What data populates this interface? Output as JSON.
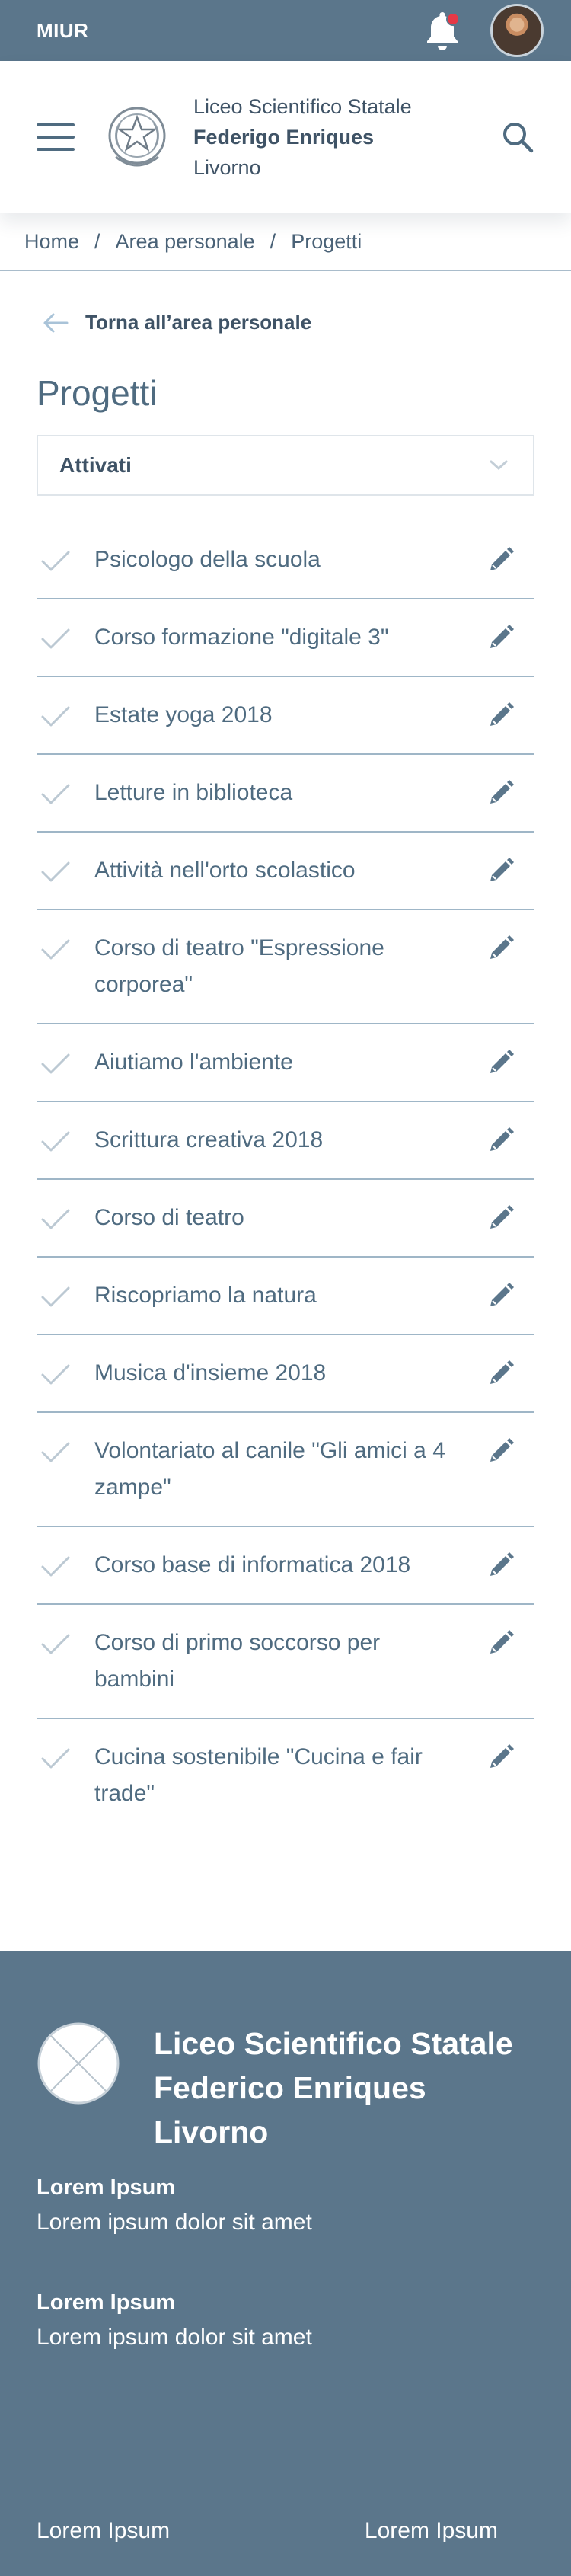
{
  "topbar": {
    "brand": "MIUR",
    "notification_badge_color": "#e63946"
  },
  "header": {
    "school_line1": "Liceo Scientifico Statale",
    "school_line2": "Federigo Enriques",
    "school_line3": "Livorno"
  },
  "breadcrumb": {
    "home": "Home",
    "area": "Area personale",
    "current": "Progetti",
    "separator": "/"
  },
  "back_link": {
    "label": "Torna all’area personale"
  },
  "page_title": "Progetti",
  "filter": {
    "selected": "Attivati"
  },
  "projects": [
    "Psicologo della scuola",
    "Corso formazione \"digitale 3\"",
    "Estate yoga 2018",
    "Letture in biblioteca",
    "Attività nell'orto scolastico",
    "Corso di teatro \"Espressione corporea\"",
    "Aiutiamo l'ambiente",
    "Scrittura creativa 2018",
    "Corso di teatro",
    "Riscopriamo la natura",
    "Musica d'insieme 2018",
    "Volontariato al canile \"Gli amici a 4 zampe\"",
    "Corso base di informatica 2018",
    "Corso di primo soccorso per bambini",
    "Cucina sostenibile \"Cucina e fair trade\""
  ],
  "footer": {
    "title_line1": "Liceo Scientifico Statale",
    "title_line2": "Federico Enriques",
    "title_line3": "Livorno",
    "block1_heading": "Lorem Ipsum",
    "block1_text": "Lorem ipsum dolor sit amet",
    "block2_heading": "Lorem Ipsum",
    "block2_text": "Lorem ipsum dolor sit amet",
    "link_left": "Lorem Ipsum",
    "link_right": "Lorem Ipsum"
  },
  "colors": {
    "primary": "#5b768b",
    "text": "#4f6b80",
    "divider": "#9fb6c7"
  }
}
